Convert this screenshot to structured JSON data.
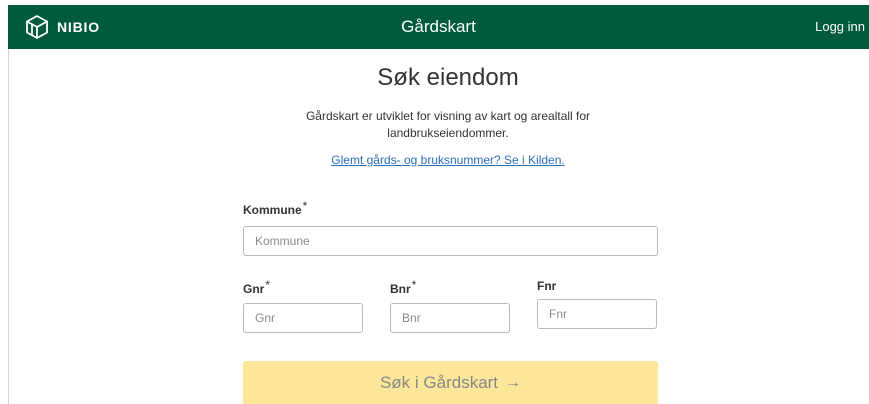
{
  "header": {
    "brand": "NIBIO",
    "logo_icon": "nibio-cube-logo-icon",
    "title": "Gårdskart",
    "login_label": "Logg inn",
    "background_color": "#005a3c"
  },
  "main": {
    "title": "Søk eiendom",
    "intro": "Gårdskart er utviklet for visning av kart og arealtall for landbrukseiendommer.",
    "kilden_link": "Glemt gårds- og bruksnummer? Se i Kilden."
  },
  "form": {
    "kommune": {
      "label": "Kommune",
      "required_mark": "*",
      "placeholder": "Kommune",
      "value": ""
    },
    "gnr": {
      "label": "Gnr",
      "required_mark": "*",
      "placeholder": "Gnr",
      "value": ""
    },
    "bnr": {
      "label": "Bnr",
      "required_mark": "*",
      "placeholder": "Bnr",
      "value": ""
    },
    "fnr": {
      "label": "Fnr",
      "placeholder": "Fnr",
      "value": ""
    },
    "submit": {
      "label": "Søk i Gårdskart",
      "icon": "arrow-right-icon",
      "color": "#fbe699"
    }
  }
}
